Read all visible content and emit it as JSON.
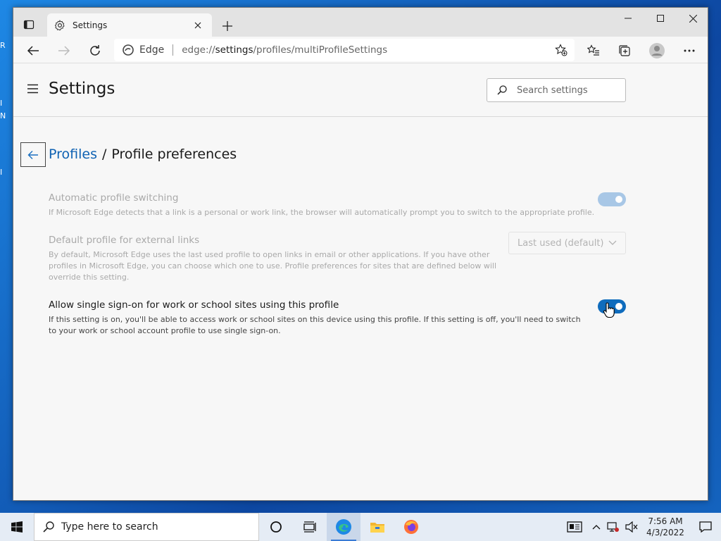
{
  "desktop": {
    "stubs": [
      "R",
      "I",
      "N",
      "I"
    ]
  },
  "browser": {
    "tab_title": "Settings",
    "address_brand": "Edge",
    "url_scheme": "edge://",
    "url_host": "settings",
    "url_path": "/profiles/multiProfileSettings"
  },
  "settings": {
    "title": "Settings",
    "search_placeholder": "Search settings"
  },
  "breadcrumb": {
    "parent": "Profiles",
    "separator": "/",
    "current": "Profile preferences"
  },
  "rows": [
    {
      "title": "Automatic profile switching",
      "description": "If Microsoft Edge detects that a link is a personal or work link, the browser will automatically prompt you to switch to the appropriate profile.",
      "state": "on",
      "enabled": false
    },
    {
      "title": "Default profile for external links",
      "description": "By default, Microsoft Edge uses the last used profile to open links in email or other applications. If you have other profiles in Microsoft Edge, you can choose which one to use. Profile preferences for sites that are defined below will override this setting.",
      "selected": "Last used (default)",
      "enabled": false
    },
    {
      "title": "Allow single sign-on for work or school sites using this profile",
      "description": "If this setting is on, you'll be able to access work or school sites on this device using this profile. If this setting is off, you'll need to switch to your work or school account profile to use single sign-on.",
      "state": "on",
      "enabled": true
    }
  ],
  "taskbar": {
    "search_placeholder": "Type here to search",
    "time": "7:56 AM",
    "date": "4/3/2022"
  },
  "colors": {
    "accent": "#0f6cbd",
    "link": "#0f62b3"
  }
}
